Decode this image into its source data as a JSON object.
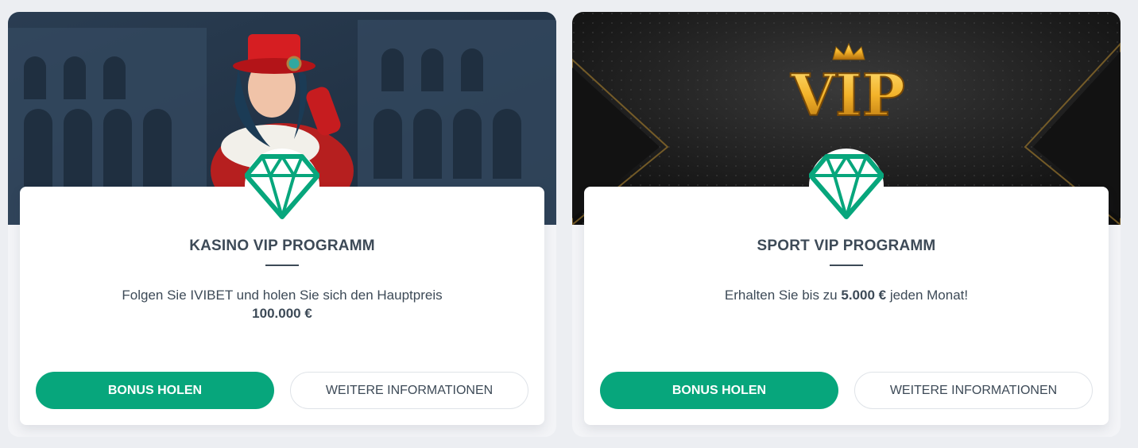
{
  "promos": [
    {
      "title": "KASINO VIP PROGRAMM",
      "desc_text": "Folgen Sie IVIBET und holen Sie sich den Hauptpreis",
      "desc_amount": "100.000 €",
      "bonus_button": "BONUS HOLEN",
      "info_button": "WEITERE INFORMATIONEN"
    },
    {
      "title": "SPORT VIP PROGRAMM",
      "desc_before": "Erhalten Sie bis zu",
      "desc_amount": "5.000 €",
      "desc_after": "jeden Monat!",
      "bonus_button": "BONUS HOLEN",
      "info_button": "WEITERE INFORMATIONEN",
      "banner_logo": "VIP"
    }
  ],
  "icons": {
    "diamond": "diamond-icon",
    "crown": "crown-icon"
  },
  "colors": {
    "accent": "#07a67c",
    "text": "#3d4a57",
    "gold": "#f3b32a"
  }
}
